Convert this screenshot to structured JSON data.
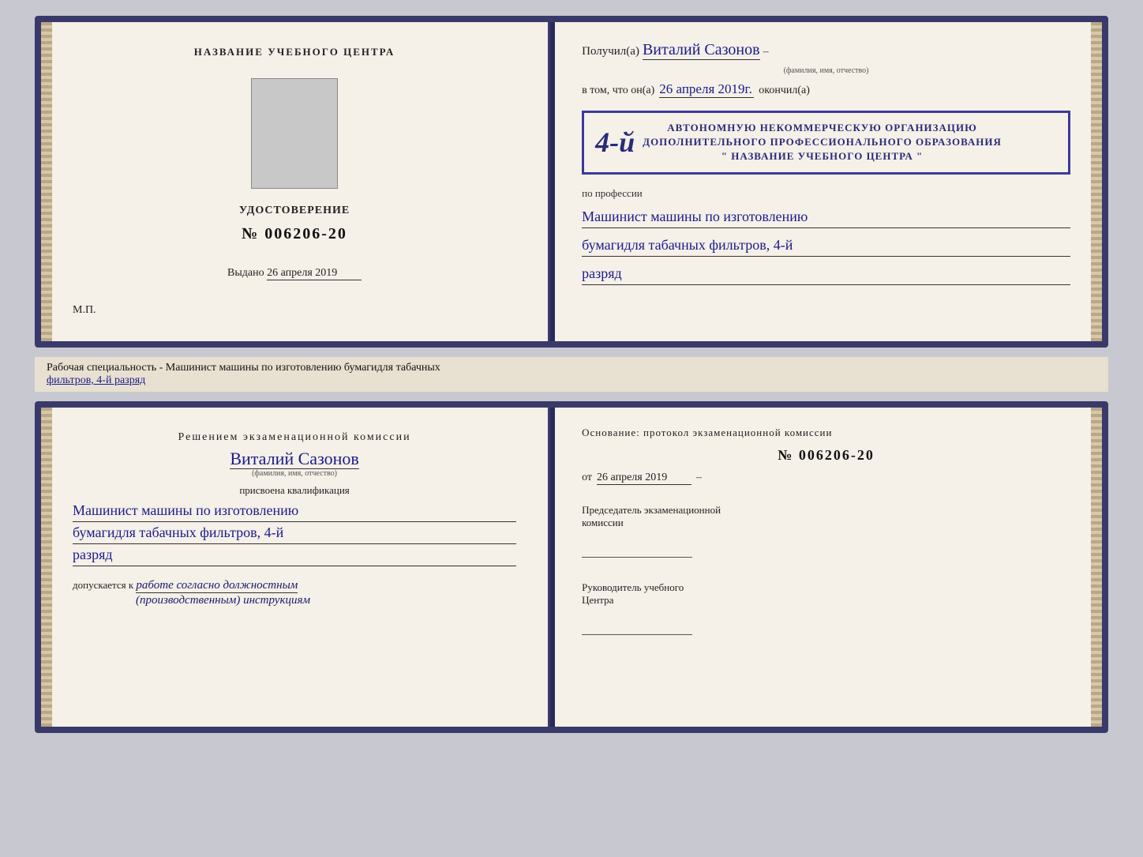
{
  "topDoc": {
    "left": {
      "centerTitle": "НАЗВАНИЕ УЧЕБНОГО ЦЕНТРА",
      "certLabel": "УДОСТОВЕРЕНИЕ",
      "certNumberPrefix": "№",
      "certNumber": "006206-20",
      "issuedLabel": "Выдано",
      "issuedDate": "26 апреля 2019",
      "mpLabel": "М.П."
    },
    "right": {
      "recipientPrefix": "Получил(а)",
      "recipientName": "Виталий Сазонов",
      "recipientCaption": "(фамилия, имя, отчество)",
      "inThatPrefix": "в том, что он(а)",
      "completedDate": "26 апреля 2019г.",
      "completedSuffix": "окончил(а)",
      "stampBigNumber": "4-й",
      "stampLine1": "АВТОНОМНУЮ НЕКОММЕРЧЕСКУЮ ОРГАНИЗАЦИЮ",
      "stampLine2": "ДОПОЛНИТЕЛЬНОГО ПРОФЕССИОНАЛЬНОГО ОБРАЗОВАНИЯ",
      "stampLine3": "\" НАЗВАНИЕ УЧЕБНОГО ЦЕНТРА \"",
      "professionLabel": "по профессии",
      "professionLine1": "Машинист машины по изготовлению",
      "professionLine2": "бумагидля табачных фильтров, 4-й",
      "professionLine3": "разряд",
      "dashRight": "–"
    }
  },
  "workSpecialtyBar": {
    "prefix": "Рабочая специальность - Машинист машины по изготовлению бумагидля табачных",
    "underlinedPart": "фильтров, 4-й разряд"
  },
  "bottomDoc": {
    "left": {
      "commissionTitle": "Решением  экзаменационной  комиссии",
      "personName": "Виталий Сазонов",
      "personCaption": "(фамилия, имя, отчество)",
      "assignedLabel": "присвоена квалификация",
      "qualLine1": "Машинист  машины  по изготовлению",
      "qualLine2": "бумагидля табачных фильтров, 4-й",
      "qualLine3": "разряд",
      "allowedPrefix": "допускается к",
      "allowedValue": "работе согласно должностным",
      "allowedValue2": "(производственным) инструкциям"
    },
    "right": {
      "basisLabel": "Основание:  протокол  экзаменационной  комиссии",
      "basisNumberPrefix": "№",
      "basisNumber": "006206-20",
      "basisDatePrefix": "от",
      "basisDate": "26 апреля 2019",
      "chairmanLabel": "Председатель экзаменационной",
      "chairmanLabel2": "комиссии",
      "headLabel": "Руководитель учебного",
      "headLabel2": "Центра",
      "dashRight": "–"
    }
  }
}
